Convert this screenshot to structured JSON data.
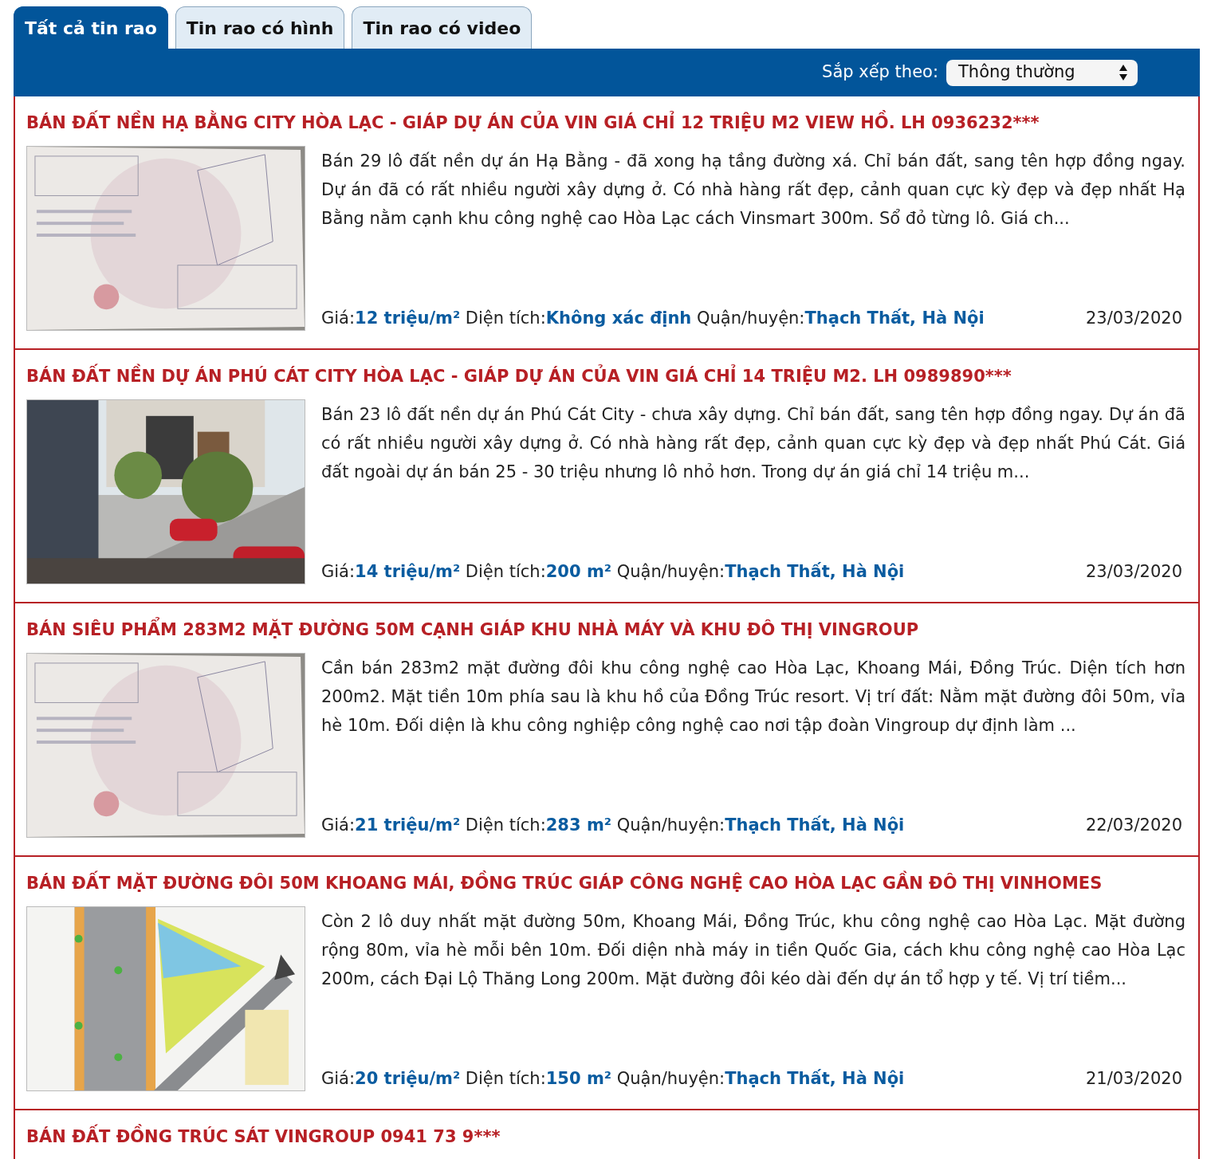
{
  "tabs": [
    {
      "label": "Tất cả tin rao",
      "selected": true
    },
    {
      "label": "Tin rao có hình",
      "selected": false
    },
    {
      "label": "Tin rao có video",
      "selected": false
    }
  ],
  "sort": {
    "label": "Sắp xếp theo:",
    "value": "Thông thường"
  },
  "listings": [
    {
      "title": "BÁN ĐẤT NỀN HẠ BẰNG CITY HÒA LẠC - GIÁP DỰ ÁN CỦA VIN GIÁ CHỈ 12 TRIỆU M2 VIEW HỒ. LH 0936232***",
      "image": {
        "kind": "document"
      },
      "description": "Bán 29 lô đất nền dự án Hạ Bằng - đã xong hạ tầng đường xá. Chỉ bán đất, sang tên hợp đồng ngay. Dự án đã có rất nhiều người xây dựng ở. Có nhà hàng rất đẹp, cảnh quan cực kỳ đẹp và đẹp nhất Hạ Bằng nằm cạnh khu công nghệ cao Hòa Lạc cách Vinsmart 300m. Sổ đỏ từng lô. Giá ch...",
      "facts": [
        {
          "label": "Giá:",
          "value": "12 triệu/m²"
        },
        {
          "label": "Diện tích:",
          "value": "Không xác định"
        },
        {
          "label": "Quận/huyện:",
          "value": "Thạch Thất, Hà Nội"
        }
      ],
      "date": "23/03/2020"
    },
    {
      "title": "BÁN ĐẤT NỀN DỰ ÁN PHÚ CÁT CITY HÒA LẠC - GIÁP DỰ ÁN CỦA VIN GIÁ CHỈ 14 TRIỆU M2. LH 0989890***",
      "image": {
        "kind": "street"
      },
      "description": "Bán 23 lô đất nền dự án Phú Cát City - chưa xây dựng. Chỉ bán đất, sang tên hợp đồng ngay. Dự án đã có rất nhiều người xây dựng ở. Có nhà hàng rất đẹp, cảnh quan cực kỳ đẹp và đẹp nhất Phú Cát. Giá đất ngoài dự án bán 25 - 30 triệu nhưng lô nhỏ hơn. Trong dự án giá chỉ 14 triệu m...",
      "facts": [
        {
          "label": "Giá:",
          "value": "14 triệu/m²"
        },
        {
          "label": "Diện tích:",
          "value": "200 m²"
        },
        {
          "label": "Quận/huyện:",
          "value": "Thạch Thất, Hà Nội"
        }
      ],
      "date": "23/03/2020"
    },
    {
      "title": "BÁN SIÊU PHẨM 283M2 MẶT ĐƯỜNG 50M CẠNH GIÁP KHU NHÀ MÁY VÀ KHU ĐÔ THỊ VINGROUP",
      "image": {
        "kind": "document"
      },
      "description": "Cần bán 283m2 mặt đường đôi khu công nghệ cao Hòa Lạc, Khoang Mái, Đồng Trúc. Diện tích hơn 200m2. Mặt tiền 10m phía sau là khu hồ của Đồng Trúc resort. Vị trí đất: Nằm mặt đường đôi 50m, vỉa hè 10m. Đối diện là khu công nghiệp công nghệ cao nơi tập đoàn Vingroup dự định làm ...",
      "facts": [
        {
          "label": "Giá:",
          "value": "21 triệu/m²"
        },
        {
          "label": "Diện tích:",
          "value": "283 m²"
        },
        {
          "label": "Quận/huyện:",
          "value": "Thạch Thất, Hà Nội"
        }
      ],
      "date": "22/03/2020"
    },
    {
      "title": "BÁN ĐẤT MẶT ĐƯỜNG ĐÔI 50M KHOANG MÁI, ĐỒNG TRÚC GIÁP CÔNG NGHỆ CAO HÒA LẠC GẦN ĐÔ THỊ VINHOMES",
      "image": {
        "kind": "plan"
      },
      "description": "Còn 2 lô duy nhất mặt đường 50m, Khoang Mái, Đồng Trúc, khu công nghệ cao Hòa Lạc. Mặt đường rộng 80m, vỉa hè mỗi bên 10m. Đối diện nhà máy in tiền Quốc Gia, cách khu công nghệ cao Hòa Lạc 200m, cách Đại Lộ Thăng Long 200m. Mặt đường đôi kéo dài đến dự án tổ hợp y tế. Vị trí tiềm...",
      "facts": [
        {
          "label": "Giá:",
          "value": "20 triệu/m²"
        },
        {
          "label": "Diện tích:",
          "value": "150 m²"
        },
        {
          "label": "Quận/huyện:",
          "value": "Thạch Thất, Hà Nội"
        }
      ],
      "date": "21/03/2020"
    },
    {
      "title": "BÁN ĐẤT ĐỒNG TRÚC SÁT VINGROUP 0941 73 9***"
    }
  ]
}
